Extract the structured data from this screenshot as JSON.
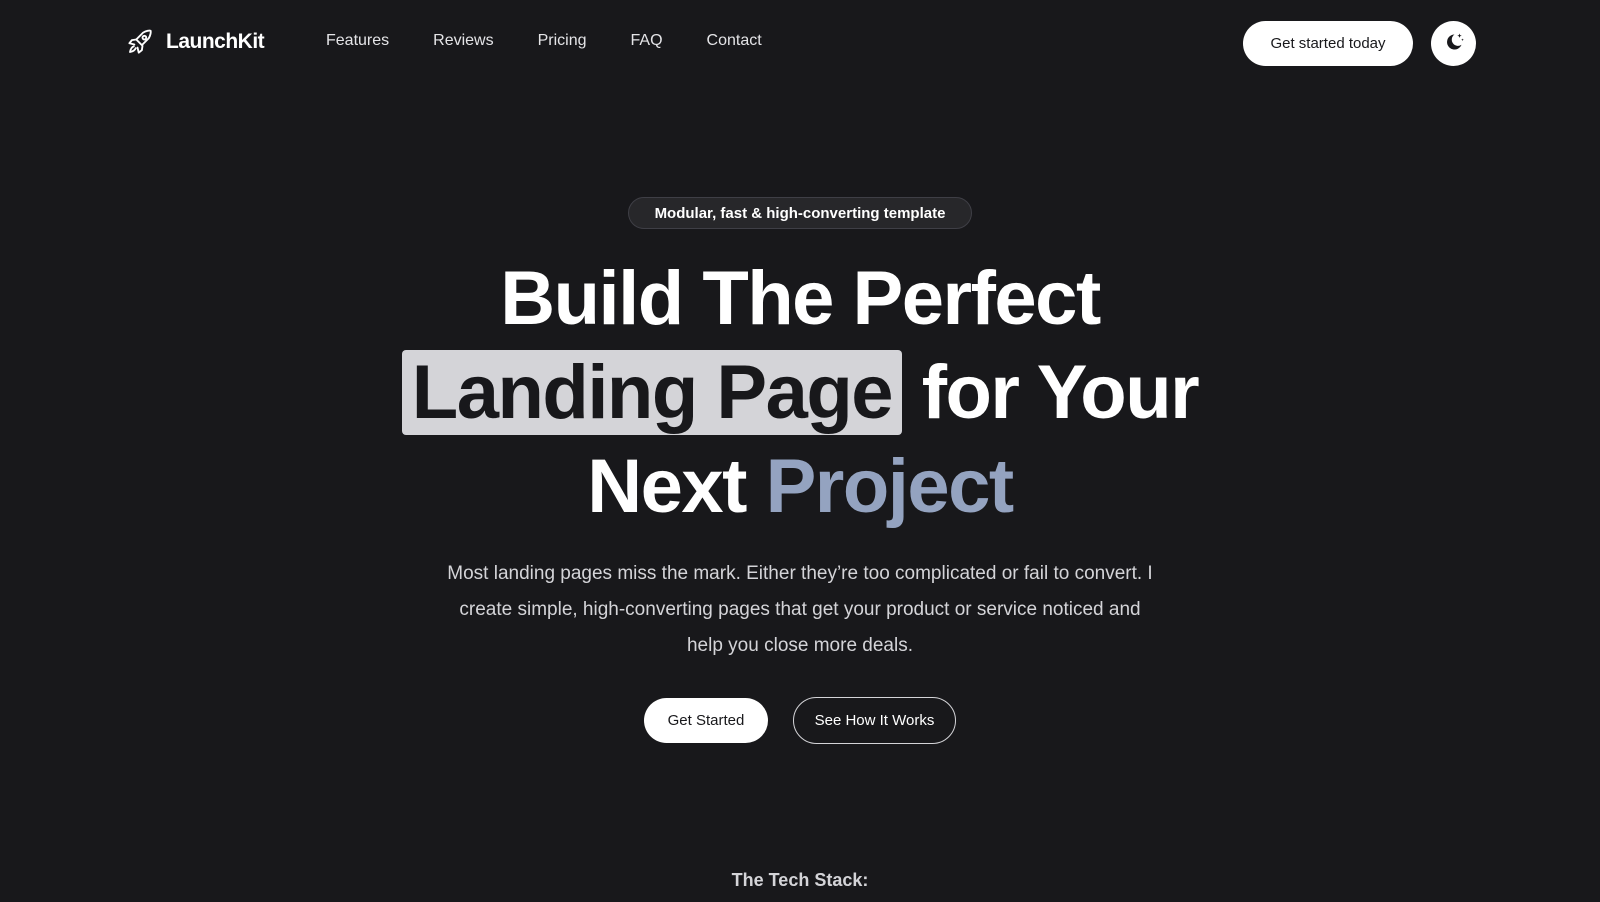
{
  "brand": {
    "name": "LaunchKit",
    "logo_icon": "rocket-icon"
  },
  "nav": {
    "links": [
      "Features",
      "Reviews",
      "Pricing",
      "FAQ",
      "Contact"
    ],
    "cta_label": "Get started today",
    "theme_icon": "moon-stars-icon"
  },
  "hero": {
    "badge": "Modular, fast & high-converting template",
    "headline": {
      "line1": "Build The Perfect",
      "highlight": "Landing Page",
      "line2_rest": "for Your",
      "line3_start": "Next",
      "accent": "Project"
    },
    "subtitle": "Most landing pages miss the mark. Either they’re too complicated or fail to convert. I create simple, high-converting pages that get your product or service noticed and help you close more deals.",
    "primary_button": "Get Started",
    "secondary_button": "See How It Works"
  },
  "tech_stack": {
    "heading": "The Tech Stack:"
  },
  "colors": {
    "background": "#18181b",
    "highlight_bg": "#d4d4d8",
    "accent": "#94a3c0"
  }
}
